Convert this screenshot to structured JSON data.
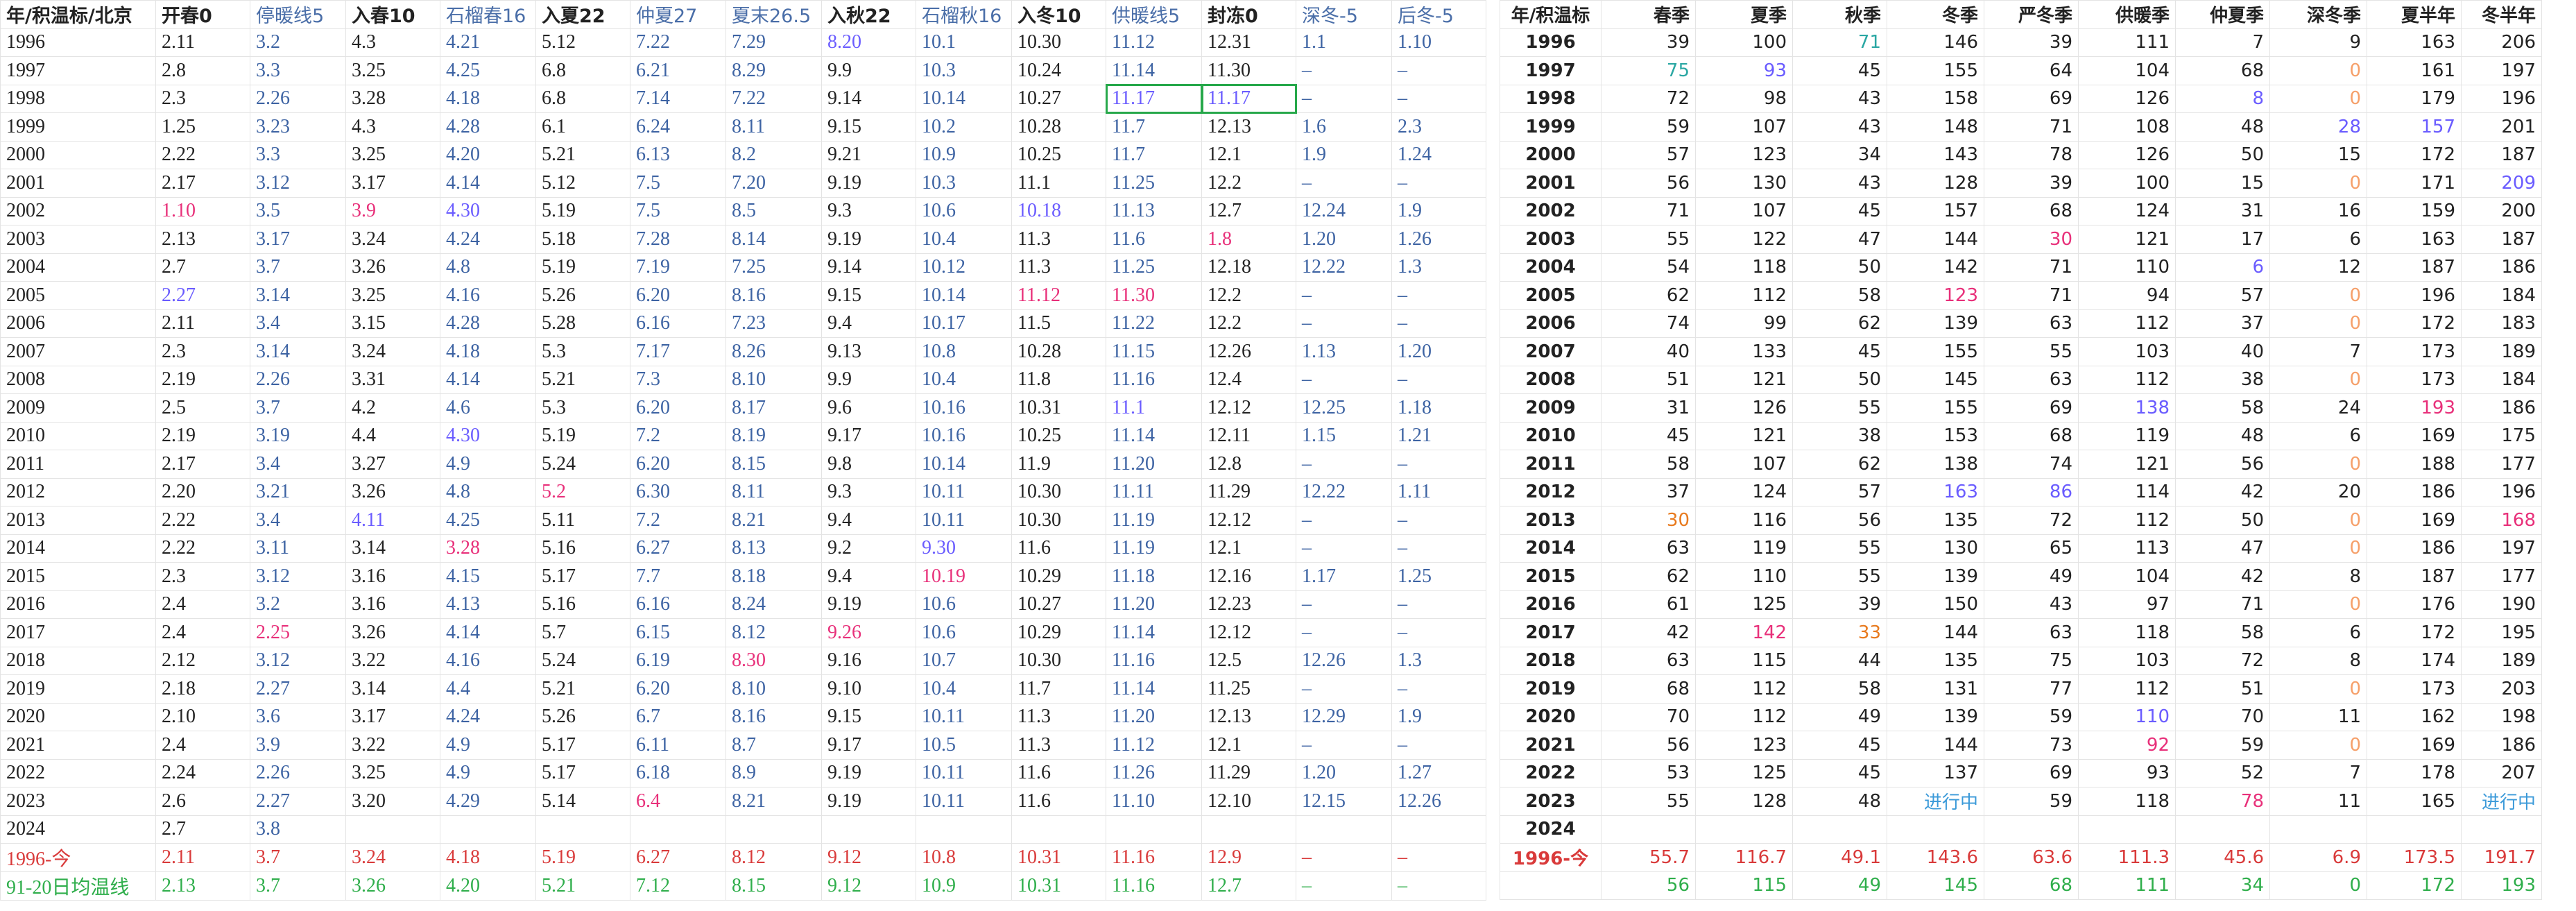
{
  "colors": {
    "black": "#222222",
    "blue": "#3d63a3",
    "highlight_red": "#e8307a",
    "highlight_violet": "#6a5cff",
    "highlight_orange": "#e87a1e",
    "highlight_peach": "#f6a06a",
    "highlight_teal": "#2aa7a3",
    "avg_row": "#d93a3a",
    "day91_row": "#2fae4b",
    "in_progress": "#3b9ad9",
    "selection_border": "#27a84b"
  },
  "left_table": {
    "headers": [
      "年/积温标/北京",
      "开春0",
      "停暖线5",
      "入春10",
      "石榴春16",
      "入夏22",
      "仲夏27",
      "夏末26.5",
      "入秋22",
      "石榴秋16",
      "入冬10",
      "供暖线5",
      "封冻0",
      "深冬-5",
      "后冬-5"
    ],
    "rows": [
      [
        "1996",
        "2.11",
        "3.2",
        "4.3",
        "4.21",
        "5.12",
        "7.22",
        "7.29",
        "8.20",
        "10.1",
        "10.30",
        "11.12",
        "12.31",
        "1.1",
        "1.10"
      ],
      [
        "1997",
        "2.8",
        "3.3",
        "3.25",
        "4.25",
        "6.8",
        "6.21",
        "8.29",
        "9.9",
        "10.3",
        "10.24",
        "11.14",
        "11.30",
        "–",
        "–"
      ],
      [
        "1998",
        "2.3",
        "2.26",
        "3.28",
        "4.18",
        "6.8",
        "7.14",
        "7.22",
        "9.14",
        "10.14",
        "10.27",
        "11.17",
        "11.17",
        "–",
        "–"
      ],
      [
        "1999",
        "1.25",
        "3.23",
        "4.3",
        "4.28",
        "6.1",
        "6.24",
        "8.11",
        "9.15",
        "10.2",
        "10.28",
        "11.7",
        "12.13",
        "1.6",
        "2.3"
      ],
      [
        "2000",
        "2.22",
        "3.3",
        "3.25",
        "4.20",
        "5.21",
        "6.13",
        "8.2",
        "9.21",
        "10.9",
        "10.25",
        "11.7",
        "12.1",
        "1.9",
        "1.24"
      ],
      [
        "2001",
        "2.17",
        "3.12",
        "3.17",
        "4.14",
        "5.12",
        "7.5",
        "7.20",
        "9.19",
        "10.3",
        "11.1",
        "11.25",
        "12.2",
        "–",
        "–"
      ],
      [
        "2002",
        "1.10",
        "3.5",
        "3.9",
        "4.30",
        "5.19",
        "7.5",
        "8.5",
        "9.3",
        "10.6",
        "10.18",
        "11.13",
        "12.7",
        "12.24",
        "1.9"
      ],
      [
        "2003",
        "2.13",
        "3.17",
        "3.24",
        "4.24",
        "5.18",
        "7.28",
        "8.14",
        "9.19",
        "10.4",
        "11.3",
        "11.6",
        "1.8",
        "1.20",
        "1.26"
      ],
      [
        "2004",
        "2.7",
        "3.7",
        "3.26",
        "4.8",
        "5.19",
        "7.19",
        "7.25",
        "9.14",
        "10.12",
        "11.3",
        "11.25",
        "12.18",
        "12.22",
        "1.3"
      ],
      [
        "2005",
        "2.27",
        "3.14",
        "3.25",
        "4.16",
        "5.26",
        "6.20",
        "8.16",
        "9.15",
        "10.14",
        "11.12",
        "11.30",
        "12.2",
        "–",
        "–"
      ],
      [
        "2006",
        "2.11",
        "3.4",
        "3.15",
        "4.28",
        "5.28",
        "6.16",
        "7.23",
        "9.4",
        "10.17",
        "11.5",
        "11.22",
        "12.2",
        "–",
        "–"
      ],
      [
        "2007",
        "2.3",
        "3.14",
        "3.24",
        "4.18",
        "5.3",
        "7.17",
        "8.26",
        "9.13",
        "10.8",
        "10.28",
        "11.15",
        "12.26",
        "1.13",
        "1.20"
      ],
      [
        "2008",
        "2.19",
        "2.26",
        "3.31",
        "4.14",
        "5.21",
        "7.3",
        "8.10",
        "9.9",
        "10.4",
        "11.8",
        "11.16",
        "12.4",
        "–",
        "–"
      ],
      [
        "2009",
        "2.5",
        "3.7",
        "4.2",
        "4.6",
        "5.3",
        "6.20",
        "8.17",
        "9.6",
        "10.16",
        "10.31",
        "11.1",
        "12.12",
        "12.25",
        "1.18"
      ],
      [
        "2010",
        "2.19",
        "3.19",
        "4.4",
        "4.30",
        "5.19",
        "7.2",
        "8.19",
        "9.17",
        "10.16",
        "10.25",
        "11.14",
        "12.11",
        "1.15",
        "1.21"
      ],
      [
        "2011",
        "2.17",
        "3.4",
        "3.27",
        "4.9",
        "5.24",
        "6.20",
        "8.15",
        "9.8",
        "10.14",
        "11.9",
        "11.20",
        "12.8",
        "–",
        "–"
      ],
      [
        "2012",
        "2.20",
        "3.21",
        "3.26",
        "4.8",
        "5.2",
        "6.30",
        "8.11",
        "9.3",
        "10.11",
        "10.30",
        "11.11",
        "11.29",
        "12.22",
        "1.11"
      ],
      [
        "2013",
        "2.22",
        "3.4",
        "4.11",
        "4.25",
        "5.11",
        "7.2",
        "8.21",
        "9.4",
        "10.11",
        "10.30",
        "11.19",
        "12.12",
        "–",
        "–"
      ],
      [
        "2014",
        "2.22",
        "3.11",
        "3.14",
        "3.28",
        "5.16",
        "6.27",
        "8.13",
        "9.2",
        "9.30",
        "11.6",
        "11.19",
        "12.1",
        "–",
        "–"
      ],
      [
        "2015",
        "2.3",
        "3.12",
        "3.16",
        "4.15",
        "5.17",
        "7.7",
        "8.18",
        "9.4",
        "10.19",
        "10.29",
        "11.18",
        "12.16",
        "1.17",
        "1.25"
      ],
      [
        "2016",
        "2.4",
        "3.2",
        "3.16",
        "4.13",
        "5.16",
        "6.16",
        "8.24",
        "9.19",
        "10.6",
        "10.27",
        "11.20",
        "12.23",
        "–",
        "–"
      ],
      [
        "2017",
        "2.4",
        "2.25",
        "3.26",
        "4.14",
        "5.7",
        "6.15",
        "8.12",
        "9.26",
        "10.6",
        "10.29",
        "11.14",
        "12.12",
        "–",
        "–"
      ],
      [
        "2018",
        "2.12",
        "3.12",
        "3.22",
        "4.16",
        "5.24",
        "6.19",
        "8.30",
        "9.16",
        "10.7",
        "10.30",
        "11.16",
        "12.5",
        "12.26",
        "1.3"
      ],
      [
        "2019",
        "2.18",
        "2.27",
        "3.14",
        "4.4",
        "5.21",
        "6.20",
        "8.10",
        "9.10",
        "10.4",
        "11.7",
        "11.14",
        "11.25",
        "–",
        "–"
      ],
      [
        "2020",
        "2.10",
        "3.6",
        "3.17",
        "4.24",
        "5.26",
        "6.7",
        "8.16",
        "9.15",
        "10.11",
        "11.3",
        "11.20",
        "12.13",
        "12.29",
        "1.9"
      ],
      [
        "2021",
        "2.4",
        "3.9",
        "3.22",
        "4.9",
        "5.17",
        "6.11",
        "8.7",
        "9.17",
        "10.5",
        "11.3",
        "11.12",
        "12.1",
        "–",
        "–"
      ],
      [
        "2022",
        "2.24",
        "2.26",
        "3.25",
        "4.9",
        "5.17",
        "6.18",
        "8.9",
        "9.19",
        "10.11",
        "11.6",
        "11.26",
        "11.29",
        "1.20",
        "1.27"
      ],
      [
        "2023",
        "2.6",
        "2.27",
        "3.20",
        "4.29",
        "5.14",
        "6.4",
        "8.21",
        "9.19",
        "10.11",
        "11.6",
        "11.10",
        "12.10",
        "12.15",
        "12.26"
      ],
      [
        "2024",
        "2.7",
        "3.8",
        "",
        "",
        "",
        "",
        "",
        "",
        "",
        "",
        "",
        "",
        "",
        ""
      ]
    ],
    "avg_row": [
      "1996-今",
      "2.11",
      "3.7",
      "3.24",
      "4.18",
      "5.19",
      "6.27",
      "8.12",
      "9.12",
      "10.8",
      "10.31",
      "11.16",
      "12.9",
      "–",
      "–"
    ],
    "day91_row": [
      "91-20日均温线",
      "2.13",
      "3.7",
      "3.26",
      "4.20",
      "5.21",
      "7.12",
      "8.15",
      "9.12",
      "10.9",
      "10.31",
      "11.16",
      "12.7",
      "–",
      "–"
    ],
    "blue_columns": [
      2,
      4,
      6,
      7,
      9,
      11,
      13,
      14
    ],
    "special": [
      {
        "r": 0,
        "c": 8,
        "color": "#6a5cff"
      },
      {
        "r": 2,
        "c": 11,
        "color": "#6a5cff",
        "box": true
      },
      {
        "r": 2,
        "c": 12,
        "color": "#6a5cff",
        "box": true
      },
      {
        "r": 6,
        "c": 1,
        "color": "#e8307a"
      },
      {
        "r": 6,
        "c": 3,
        "color": "#e8307a"
      },
      {
        "r": 6,
        "c": 4,
        "color": "#6a5cff"
      },
      {
        "r": 6,
        "c": 10,
        "color": "#6a5cff"
      },
      {
        "r": 7,
        "c": 12,
        "color": "#e8307a"
      },
      {
        "r": 9,
        "c": 1,
        "color": "#6a5cff"
      },
      {
        "r": 9,
        "c": 10,
        "color": "#e8307a"
      },
      {
        "r": 9,
        "c": 11,
        "color": "#e8307a"
      },
      {
        "r": 13,
        "c": 11,
        "color": "#6a5cff"
      },
      {
        "r": 14,
        "c": 4,
        "color": "#6a5cff"
      },
      {
        "r": 16,
        "c": 5,
        "color": "#e8307a"
      },
      {
        "r": 17,
        "c": 3,
        "color": "#6a5cff"
      },
      {
        "r": 18,
        "c": 4,
        "color": "#e8307a"
      },
      {
        "r": 18,
        "c": 9,
        "color": "#6a5cff"
      },
      {
        "r": 19,
        "c": 9,
        "color": "#e8307a"
      },
      {
        "r": 21,
        "c": 2,
        "color": "#e8307a"
      },
      {
        "r": 21,
        "c": 8,
        "color": "#e8307a"
      },
      {
        "r": 22,
        "c": 7,
        "color": "#e8307a"
      },
      {
        "r": 27,
        "c": 6,
        "color": "#e8307a"
      }
    ]
  },
  "right_table": {
    "headers": [
      "年/积温标",
      "春季",
      "夏季",
      "秋季",
      "冬季",
      "严冬季",
      "供暖季",
      "仲夏季",
      "深冬季",
      "夏半年",
      "冬半年"
    ],
    "rows": [
      [
        "1996",
        "39",
        "100",
        "71",
        "146",
        "39",
        "111",
        "7",
        "9",
        "163",
        "206"
      ],
      [
        "1997",
        "75",
        "93",
        "45",
        "155",
        "64",
        "104",
        "68",
        "0",
        "161",
        "197"
      ],
      [
        "1998",
        "72",
        "98",
        "43",
        "158",
        "69",
        "126",
        "8",
        "0",
        "179",
        "196"
      ],
      [
        "1999",
        "59",
        "107",
        "43",
        "148",
        "71",
        "108",
        "48",
        "28",
        "157",
        "201"
      ],
      [
        "2000",
        "57",
        "123",
        "34",
        "143",
        "78",
        "126",
        "50",
        "15",
        "172",
        "187"
      ],
      [
        "2001",
        "56",
        "130",
        "43",
        "128",
        "39",
        "100",
        "15",
        "0",
        "171",
        "209"
      ],
      [
        "2002",
        "71",
        "107",
        "45",
        "157",
        "68",
        "124",
        "31",
        "16",
        "159",
        "200"
      ],
      [
        "2003",
        "55",
        "122",
        "47",
        "144",
        "30",
        "121",
        "17",
        "6",
        "163",
        "187"
      ],
      [
        "2004",
        "54",
        "118",
        "50",
        "142",
        "71",
        "110",
        "6",
        "12",
        "187",
        "186"
      ],
      [
        "2005",
        "62",
        "112",
        "58",
        "123",
        "71",
        "94",
        "57",
        "0",
        "196",
        "184"
      ],
      [
        "2006",
        "74",
        "99",
        "62",
        "139",
        "63",
        "112",
        "37",
        "0",
        "172",
        "183"
      ],
      [
        "2007",
        "40",
        "133",
        "45",
        "155",
        "55",
        "103",
        "40",
        "7",
        "173",
        "189"
      ],
      [
        "2008",
        "51",
        "121",
        "50",
        "145",
        "63",
        "112",
        "38",
        "0",
        "173",
        "184"
      ],
      [
        "2009",
        "31",
        "126",
        "55",
        "155",
        "69",
        "138",
        "58",
        "24",
        "193",
        "186"
      ],
      [
        "2010",
        "45",
        "121",
        "38",
        "153",
        "68",
        "119",
        "48",
        "6",
        "169",
        "175"
      ],
      [
        "2011",
        "58",
        "107",
        "62",
        "138",
        "74",
        "121",
        "56",
        "0",
        "188",
        "177"
      ],
      [
        "2012",
        "37",
        "124",
        "57",
        "163",
        "86",
        "114",
        "42",
        "20",
        "186",
        "196"
      ],
      [
        "2013",
        "30",
        "116",
        "56",
        "135",
        "72",
        "112",
        "50",
        "0",
        "169",
        "168"
      ],
      [
        "2014",
        "63",
        "119",
        "55",
        "130",
        "65",
        "113",
        "47",
        "0",
        "186",
        "197"
      ],
      [
        "2015",
        "62",
        "110",
        "55",
        "139",
        "49",
        "104",
        "42",
        "8",
        "187",
        "177"
      ],
      [
        "2016",
        "61",
        "125",
        "39",
        "150",
        "43",
        "97",
        "71",
        "0",
        "176",
        "190"
      ],
      [
        "2017",
        "42",
        "142",
        "33",
        "144",
        "63",
        "118",
        "58",
        "6",
        "172",
        "195"
      ],
      [
        "2018",
        "63",
        "115",
        "44",
        "135",
        "75",
        "103",
        "72",
        "8",
        "174",
        "189"
      ],
      [
        "2019",
        "68",
        "112",
        "58",
        "131",
        "77",
        "112",
        "51",
        "0",
        "173",
        "203"
      ],
      [
        "2020",
        "70",
        "112",
        "49",
        "139",
        "59",
        "110",
        "70",
        "11",
        "162",
        "198"
      ],
      [
        "2021",
        "56",
        "123",
        "45",
        "144",
        "73",
        "92",
        "59",
        "0",
        "169",
        "186"
      ],
      [
        "2022",
        "53",
        "125",
        "45",
        "137",
        "69",
        "93",
        "52",
        "7",
        "178",
        "207"
      ],
      [
        "2023",
        "55",
        "128",
        "48",
        "进行中",
        "59",
        "118",
        "78",
        "11",
        "165",
        "进行中"
      ],
      [
        "2024",
        "",
        "",
        "",
        "",
        "",
        "",
        "",
        "",
        "",
        ""
      ]
    ],
    "avg_row": [
      "1996-今",
      "55.7",
      "116.7",
      "49.1",
      "143.6",
      "63.6",
      "111.3",
      "45.6",
      "6.9",
      "173.5",
      "191.7"
    ],
    "day91_row": [
      "",
      "56",
      "115",
      "49",
      "145",
      "68",
      "111",
      "34",
      "0",
      "172",
      "193"
    ],
    "special": [
      {
        "r": 0,
        "c": 3,
        "color": "#2aa7a3"
      },
      {
        "r": 1,
        "c": 1,
        "color": "#2aa7a3"
      },
      {
        "r": 1,
        "c": 2,
        "color": "#6a5cff"
      },
      {
        "r": 1,
        "c": 8,
        "color": "#f6a06a"
      },
      {
        "r": 2,
        "c": 7,
        "color": "#6a5cff"
      },
      {
        "r": 2,
        "c": 8,
        "color": "#f6a06a"
      },
      {
        "r": 3,
        "c": 8,
        "color": "#6a5cff"
      },
      {
        "r": 3,
        "c": 9,
        "color": "#6a5cff"
      },
      {
        "r": 5,
        "c": 8,
        "color": "#f6a06a"
      },
      {
        "r": 5,
        "c": 10,
        "color": "#6a5cff"
      },
      {
        "r": 7,
        "c": 5,
        "color": "#e8307a"
      },
      {
        "r": 8,
        "c": 7,
        "color": "#6a5cff"
      },
      {
        "r": 9,
        "c": 4,
        "color": "#e8307a"
      },
      {
        "r": 9,
        "c": 8,
        "color": "#f6a06a"
      },
      {
        "r": 10,
        "c": 8,
        "color": "#f6a06a"
      },
      {
        "r": 12,
        "c": 8,
        "color": "#f6a06a"
      },
      {
        "r": 13,
        "c": 6,
        "color": "#6a5cff"
      },
      {
        "r": 13,
        "c": 9,
        "color": "#e8307a"
      },
      {
        "r": 15,
        "c": 8,
        "color": "#f6a06a"
      },
      {
        "r": 16,
        "c": 4,
        "color": "#6a5cff"
      },
      {
        "r": 16,
        "c": 5,
        "color": "#6a5cff"
      },
      {
        "r": 17,
        "c": 1,
        "color": "#e87a1e"
      },
      {
        "r": 17,
        "c": 8,
        "color": "#f6a06a"
      },
      {
        "r": 17,
        "c": 10,
        "color": "#e8307a"
      },
      {
        "r": 18,
        "c": 8,
        "color": "#f6a06a"
      },
      {
        "r": 20,
        "c": 8,
        "color": "#f6a06a"
      },
      {
        "r": 21,
        "c": 2,
        "color": "#e8307a"
      },
      {
        "r": 21,
        "c": 3,
        "color": "#e87a1e"
      },
      {
        "r": 23,
        "c": 8,
        "color": "#f6a06a"
      },
      {
        "r": 24,
        "c": 6,
        "color": "#6a5cff"
      },
      {
        "r": 25,
        "c": 6,
        "color": "#e8307a"
      },
      {
        "r": 25,
        "c": 8,
        "color": "#f6a06a"
      },
      {
        "r": 27,
        "c": 7,
        "color": "#e8307a"
      }
    ]
  }
}
